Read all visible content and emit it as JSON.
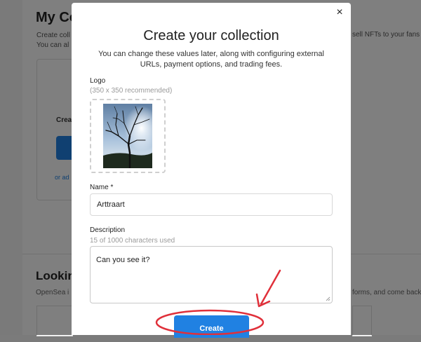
{
  "background": {
    "title": "My Co",
    "desc_line1": "Create coll",
    "desc_line2": "You can al",
    "desc_right": "sell NFTs to your fans",
    "card_title": "Crea",
    "card_link": "or ad",
    "looking_title": "Looking",
    "opensea_text": "OpenSea i",
    "right_text": "forms, and come back"
  },
  "modal": {
    "close_label": "×",
    "title": "Create your collection",
    "subtitle": "You can change these values later, along with configuring external URLs, payment options, and trading fees.",
    "logo": {
      "label": "Logo",
      "hint": "(350 x 350 recommended)"
    },
    "name": {
      "label": "Name *",
      "value": "Arttraart"
    },
    "description": {
      "label": "Description",
      "counter": "15 of 1000 characters used",
      "value": "Can you see it?"
    },
    "create_label": "Create"
  },
  "colors": {
    "accent": "#2081e2",
    "annotation": "#e0303a"
  }
}
